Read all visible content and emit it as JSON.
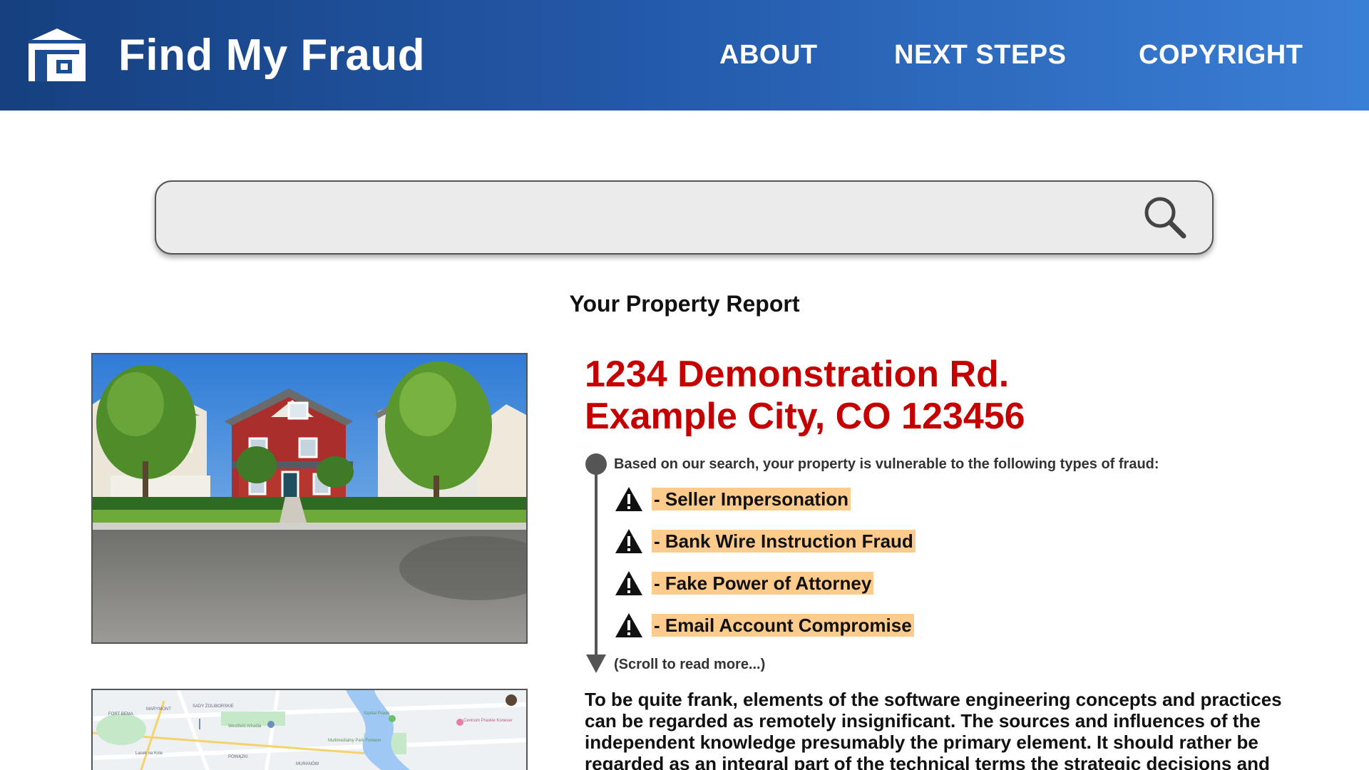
{
  "header": {
    "brand": "Find My Fraud",
    "logo_icon": "house-icon",
    "nav": [
      {
        "label": "ABOUT"
      },
      {
        "label": "NEXT STEPS"
      },
      {
        "label": "COPYRIGHT"
      }
    ]
  },
  "search": {
    "value": "",
    "placeholder": "",
    "icon": "search-icon"
  },
  "report": {
    "title": "Your Property Report",
    "address_line1": "1234 Demonstration Rd.",
    "address_line2": "Example City, CO 123456",
    "vulnerability_intro": "Based on our search, your property is vulnerable to the following types of fraud:",
    "fraud_types": [
      {
        "label": "- Seller Impersonation",
        "icon": "warning-icon"
      },
      {
        "label": "- Bank Wire Instruction Fraud",
        "icon": "warning-icon"
      },
      {
        "label": "- Fake Power of Attorney",
        "icon": "warning-icon"
      },
      {
        "label": "- Email Account Compromise",
        "icon": "warning-icon"
      }
    ],
    "scroll_hint": "(Scroll to read more...)",
    "body": "To be quite frank, elements of the software engineering concepts and practices can be regarded as remotely insignificant. The sources and influences of the independent knowledge presumably the primary element. It should rather be regarded as an integral part of the technical terms the strategic decisions and The"
  },
  "map": {
    "labels": [
      "FORT BEMA",
      "MARYMONT",
      "SADY ŻOLIBORSKIE",
      "Westfield Arkadia",
      "Szpital Praski",
      "Centrum Praskie Koneser",
      "Multimedialny Park Fontann",
      "POWĄZKI",
      "MURANÓW",
      "Lasek na Kole"
    ]
  },
  "colors": {
    "header_start": "#16407f",
    "header_end": "#3a7fd6",
    "address": "#c40000",
    "highlight": "#fdcb8b",
    "timeline": "#555555"
  }
}
